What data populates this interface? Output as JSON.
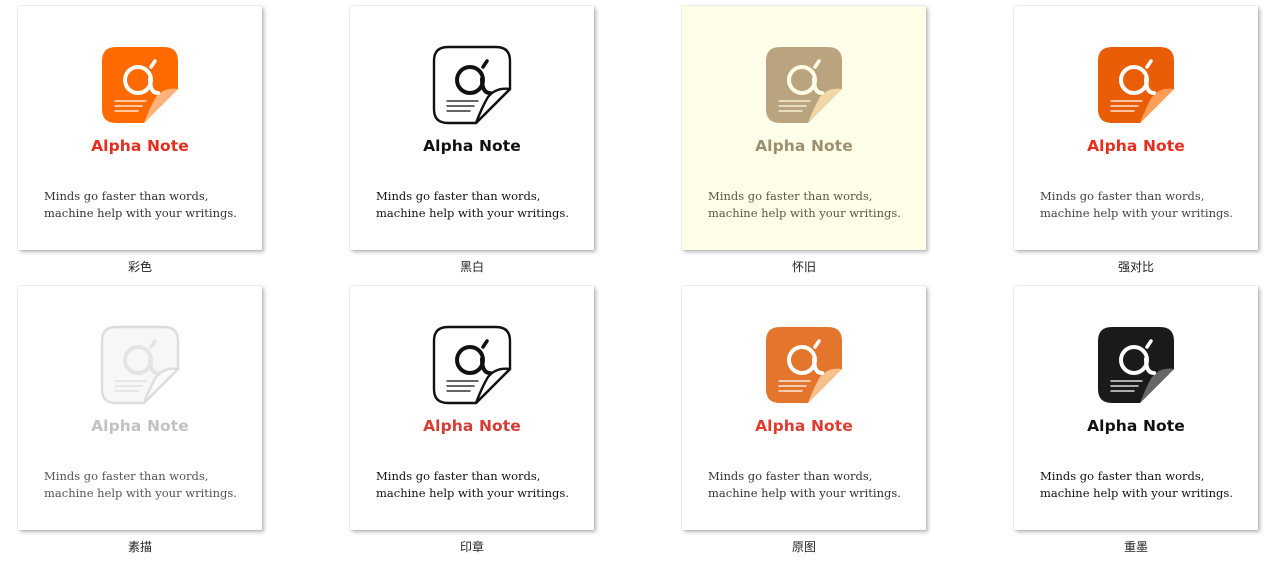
{
  "styles": [
    {
      "caption": "彩色",
      "app_name": "Alpha Note",
      "tagline_line1": "Minds go faster than words,",
      "tagline_line2": "machine help with your writings.",
      "colors": {
        "bg": "#ffffff",
        "icon": "#ff6a00",
        "fold": "#ffb27a",
        "stroke": "none",
        "glyph": "#ffffff",
        "title": "#e52e1e",
        "text": "#333333"
      }
    },
    {
      "caption": "黑白",
      "app_name": "Alpha Note",
      "tagline_line1": "Minds go faster than words,",
      "tagline_line2": "machine help with your writings.",
      "colors": {
        "bg": "#ffffff",
        "icon": "#ffffff",
        "fold": "#ffffff",
        "stroke": "#111111",
        "glyph": "#111111",
        "title": "#111111",
        "text": "#111111"
      }
    },
    {
      "caption": "怀旧",
      "app_name": "Alpha Note",
      "tagline_line1": "Minds go faster than words,",
      "tagline_line2": "machine help with your writings.",
      "colors": {
        "bg": "#fffee8",
        "icon": "#b9a47f",
        "fold": "#f1d6a6",
        "stroke": "none",
        "glyph": "#fffbe6",
        "title": "#9e8f72",
        "text": "#5d574a"
      }
    },
    {
      "caption": "强对比",
      "app_name": "Alpha Note",
      "tagline_line1": "Minds go faster than words,",
      "tagline_line2": "machine help with your writings.",
      "colors": {
        "bg": "#ffffff",
        "icon": "#e85d05",
        "fold": "#ff9e57",
        "stroke": "none",
        "glyph": "#ffffff",
        "title": "#e52e1e",
        "text": "#444444"
      }
    },
    {
      "caption": "素描",
      "app_name": "Alpha Note",
      "tagline_line1": "Minds go faster than words,",
      "tagline_line2": "machine help with your writings.",
      "colors": {
        "bg": "#ffffff",
        "icon": "#f7f7f7",
        "fold": "#fbfbfb",
        "stroke": "#dddddd",
        "glyph": "#e4e4e4",
        "title": "#c2c2c2",
        "text": "#555555"
      }
    },
    {
      "caption": "印章",
      "app_name": "Alpha Note",
      "tagline_line1": "Minds go faster than words,",
      "tagline_line2": "machine help with your writings.",
      "colors": {
        "bg": "#ffffff",
        "icon": "#ffffff",
        "fold": "#ffffff",
        "stroke": "#111111",
        "glyph": "#111111",
        "title": "#d63c36",
        "text": "#111111"
      }
    },
    {
      "caption": "原图",
      "app_name": "Alpha Note",
      "tagline_line1": "Minds go faster than words,",
      "tagline_line2": "machine help with your writings.",
      "colors": {
        "bg": "#ffffff",
        "icon": "#e3752c",
        "fold": "#f9c08e",
        "stroke": "none",
        "glyph": "#ffffff",
        "title": "#e03b2f",
        "text": "#333333"
      }
    },
    {
      "caption": "重墨",
      "app_name": "Alpha Note",
      "tagline_line1": "Minds go faster than words,",
      "tagline_line2": "machine help with your writings.",
      "colors": {
        "bg": "#ffffff",
        "icon": "#1a1a1a",
        "fold": "#666666",
        "stroke": "none",
        "glyph": "#ffffff",
        "title": "#111111",
        "text": "#111111"
      }
    }
  ]
}
